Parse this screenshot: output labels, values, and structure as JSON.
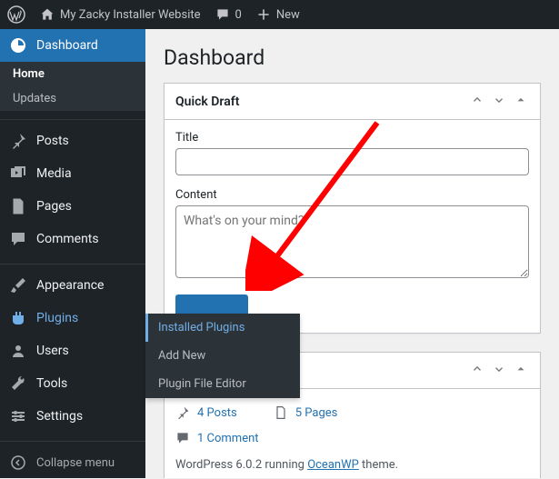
{
  "toolbar": {
    "site_name": "My Zacky Installer Website",
    "comments_count": "0",
    "new_label": "New"
  },
  "sidebar": {
    "dashboard": {
      "label": "Dashboard",
      "home": "Home",
      "updates": "Updates"
    },
    "posts": "Posts",
    "media": "Media",
    "pages": "Pages",
    "comments": "Comments",
    "appearance": "Appearance",
    "plugins": "Plugins",
    "users": "Users",
    "tools": "Tools",
    "settings": "Settings",
    "collapse": "Collapse menu"
  },
  "flyout": {
    "installed": "Installed Plugins",
    "add_new": "Add New",
    "editor": "Plugin File Editor"
  },
  "page": {
    "title": "Dashboard"
  },
  "quick_draft": {
    "heading": "Quick Draft",
    "title_label": "Title",
    "content_label": "Content",
    "content_placeholder": "What's on your mind?"
  },
  "glance": {
    "posts": "4 Posts",
    "pages": "5 Pages",
    "comments": "1 Comment",
    "footer_prefix": "WordPress 6.0.2 running ",
    "theme": "OceanWP",
    "footer_suffix": " theme."
  }
}
